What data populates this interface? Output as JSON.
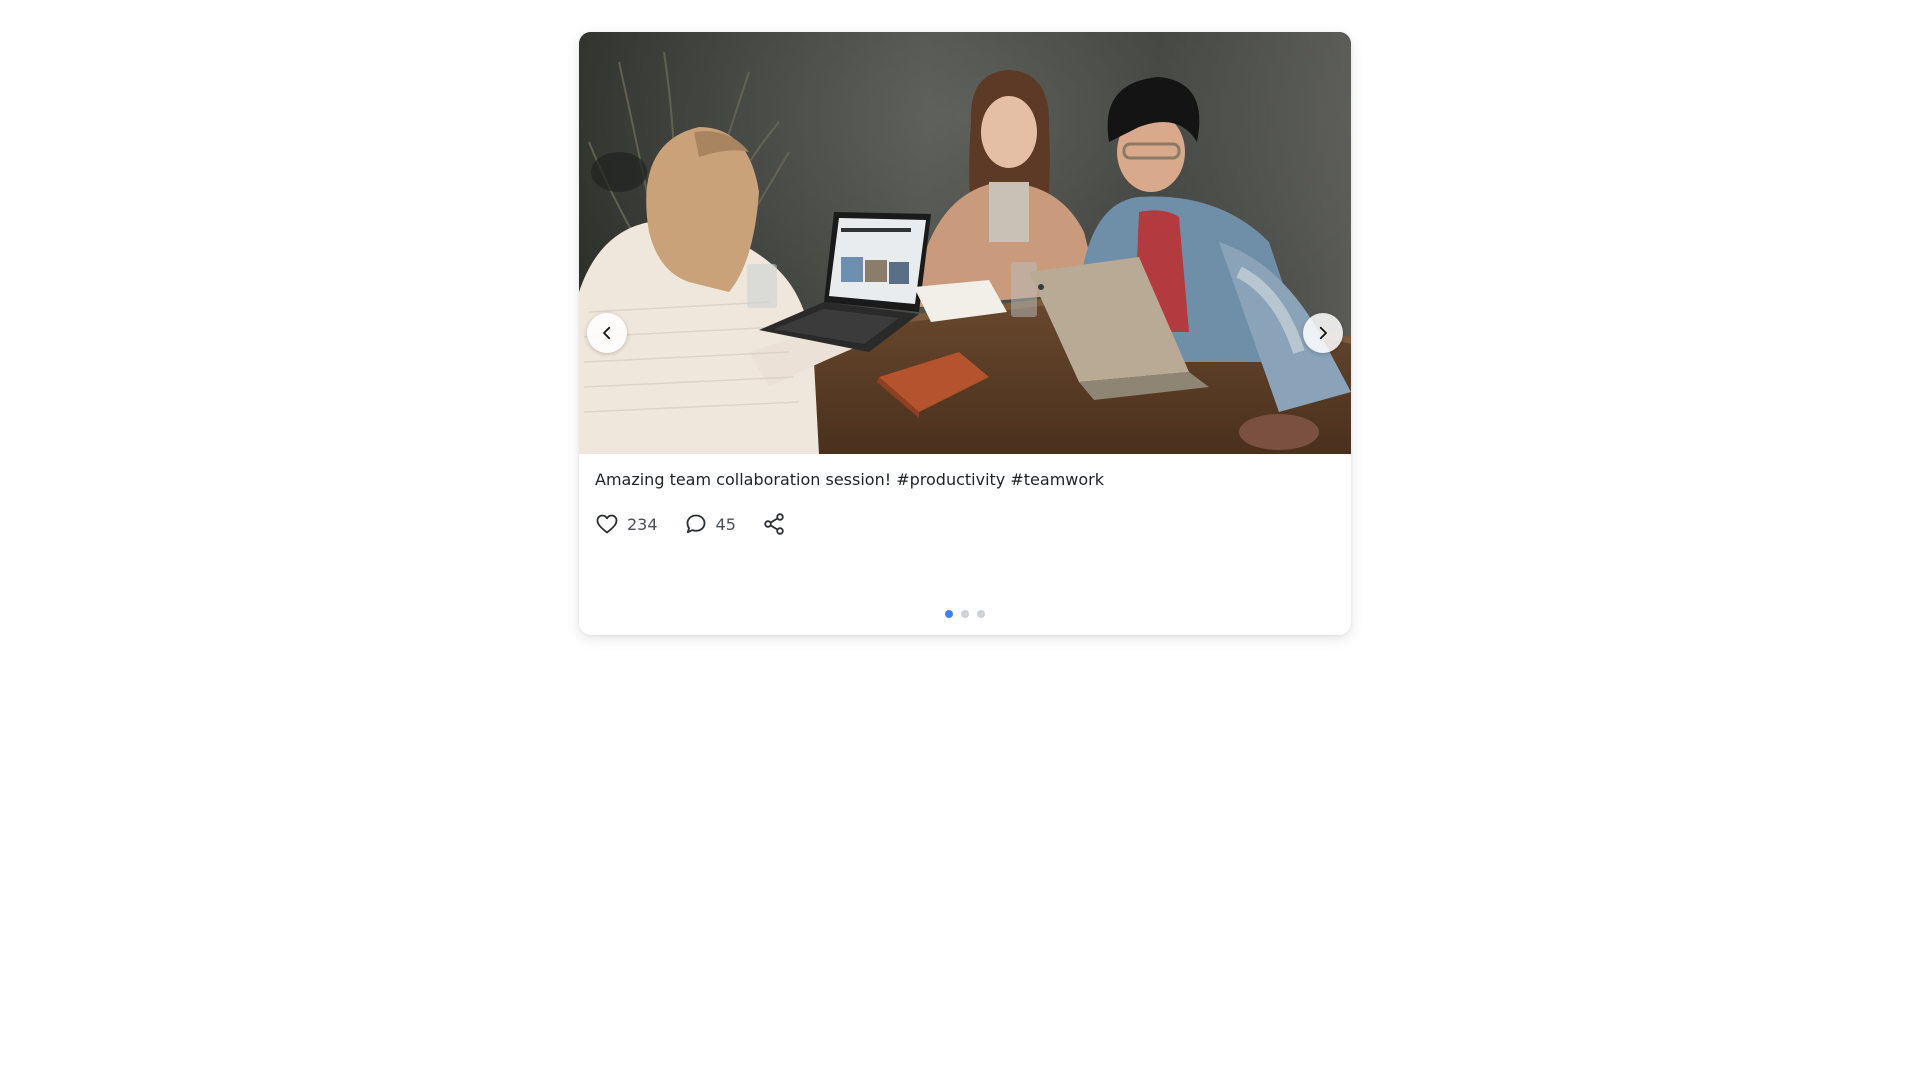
{
  "post": {
    "caption": "Amazing team collaboration session! #productivity #teamwork",
    "likes": "234",
    "comments": "45"
  },
  "carousel": {
    "slide_count": 3,
    "active_index": 0,
    "image": "photo of three people laughing at a wooden table with laptops"
  },
  "icons": {
    "prev": "chevron-left-icon",
    "next": "chevron-right-icon",
    "like": "heart-icon",
    "comment": "comment-bubble-icon",
    "share": "share-icon"
  },
  "colors": {
    "accent": "#3b82f6",
    "dot_inactive": "#cfd3d8",
    "text": "#1f2328"
  }
}
